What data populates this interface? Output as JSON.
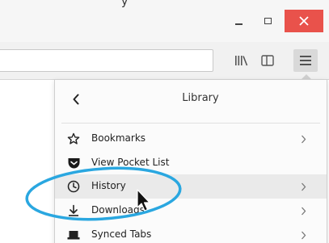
{
  "window": {
    "title_fragment": "y",
    "controls": {
      "minimize_icon": "minimize-icon",
      "maximize_icon": "maximize-icon",
      "close_icon": "close-icon"
    },
    "close_color": "#e9524b"
  },
  "toolbar": {
    "url_value": "",
    "buttons": [
      {
        "icon": "library-icon"
      },
      {
        "icon": "sidebar-icon"
      },
      {
        "icon": "hamburger-menu-icon"
      }
    ]
  },
  "library_panel": {
    "title": "Library",
    "back_icon": "back-arrow-icon",
    "items": [
      {
        "label": "Bookmarks",
        "icon": "star-icon",
        "has_submenu": true
      },
      {
        "label": "View Pocket List",
        "icon": "pocket-icon",
        "has_submenu": false
      },
      {
        "label": "History",
        "icon": "clock-icon",
        "has_submenu": true,
        "hovered": true
      },
      {
        "label": "Downloads",
        "icon": "download-icon",
        "has_submenu": true
      },
      {
        "label": "Synced Tabs",
        "icon": "synced-tabs-icon",
        "has_submenu": true
      }
    ]
  },
  "annotation": {
    "highlight_color": "#2aa7e0",
    "highlighted_item": "History"
  }
}
